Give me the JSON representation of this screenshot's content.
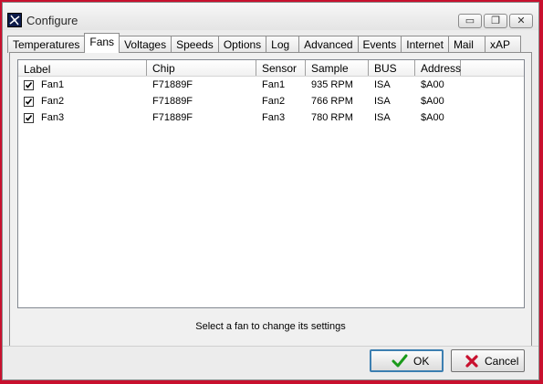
{
  "window": {
    "title": "Configure",
    "controls": {
      "minimize": "▭",
      "restore": "❐",
      "close": "✕"
    }
  },
  "tabs": [
    {
      "label": "Temperatures"
    },
    {
      "label": "Fans",
      "active": true
    },
    {
      "label": "Voltages"
    },
    {
      "label": "Speeds"
    },
    {
      "label": "Options"
    },
    {
      "label": "Log"
    },
    {
      "label": "Advanced"
    },
    {
      "label": "Events"
    },
    {
      "label": "Internet"
    },
    {
      "label": "Mail"
    },
    {
      "label": "xAP"
    }
  ],
  "fan_list": {
    "columns": [
      "Label",
      "Chip",
      "Sensor",
      "Sample",
      "BUS",
      "Address"
    ],
    "rows": [
      {
        "checked": true,
        "label": "Fan1",
        "chip": "F71889F",
        "sensor": "Fan1",
        "sample": "935 RPM",
        "bus": "ISA",
        "address": "$A00"
      },
      {
        "checked": true,
        "label": "Fan2",
        "chip": "F71889F",
        "sensor": "Fan2",
        "sample": "766 RPM",
        "bus": "ISA",
        "address": "$A00"
      },
      {
        "checked": true,
        "label": "Fan3",
        "chip": "F71889F",
        "sensor": "Fan3",
        "sample": "780 RPM",
        "bus": "ISA",
        "address": "$A00"
      }
    ]
  },
  "status": "Select a fan to change its settings",
  "buttons": {
    "ok": "OK",
    "cancel": "Cancel"
  },
  "colors": {
    "ok_icon": "#1a9a1a",
    "cancel_icon": "#c8102e",
    "desktop": "#c8102e"
  },
  "icons": {
    "app": "fan-app-icon",
    "ok": "check-icon",
    "cancel": "x-icon"
  }
}
